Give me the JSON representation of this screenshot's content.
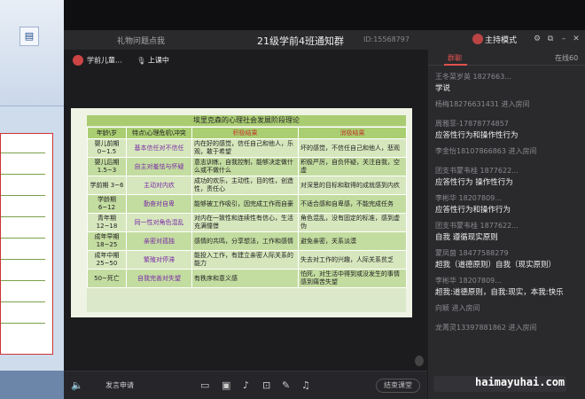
{
  "window": {
    "left_label": "礼物问题点我",
    "title": "21级学前4班通知群",
    "id_label": "ID:15568797",
    "host_mode": "主持模式"
  },
  "stage": {
    "presenter_name": "学前儿童...",
    "status": "上课中"
  },
  "slide": {
    "title": "埃里克森的心理社会发展阶段理论",
    "headers": [
      "年龄\\岁",
      "特点\\心理危机\\冲突",
      "积极结果",
      "消极结果"
    ],
    "rows": [
      [
        "婴儿前期 0~1.5",
        "基本信任对不信任",
        "内在好的感觉，信任自己和他人，乐观，敢于希望",
        "坏的感觉，不信任自己和他人，悲观"
      ],
      [
        "婴儿后期 1.5~3",
        "自主对羞怯与怀疑",
        "意志训练，自我控制，能够决定做什么或不做什么",
        "积极严厉，自负怀疑，关注自我，空虚"
      ],
      [
        "学前期 3~6",
        "主动对内疚",
        "成功的欢乐，主动性，目的性，创造性，责任心",
        "对深思的目标和取得的成就感到内疚"
      ],
      [
        "学龄期 6~12",
        "勤奋对自卑",
        "能够被工作吸引，因完成工作而自豪",
        "不适合感和自卑感，不能完成任务"
      ],
      [
        "青年期 12~18",
        "同一性对角色混乱",
        "对内在一致性和连续性有信心，生活充满憧憬",
        "角色混乱，没有固定的标准，感到虚伪"
      ],
      [
        "成年早期 18~25",
        "亲密对孤独",
        "感情的共鸣，分享想法，工作和感情",
        "避免亲密，关系淡漠"
      ],
      [
        "成年中期 25~50",
        "繁殖对停滞",
        "能投入工作，有建立亲密人际关系的能力",
        "失去对工作的兴趣，人际关系贫乏"
      ],
      [
        "50~死亡",
        "自我完善对失望",
        "有秩序和意义感",
        "怕死，对生活中得到或没发生的事情感到痛苦失望"
      ]
    ]
  },
  "toolbar": {
    "speak_label": "发言申请",
    "end_label": "结束课堂"
  },
  "chat": {
    "tab_active": "群聊",
    "tab_online": "在线60",
    "messages": [
      {
        "kind": "sender",
        "badge": true,
        "text": "王冬菜岁英 1827663..."
      },
      {
        "kind": "text",
        "text": "学说"
      },
      {
        "kind": "join",
        "text": "杨梅18276631431 进入房间"
      },
      {
        "kind": "sender",
        "badge": false,
        "text": "周雅菲-17878774857"
      },
      {
        "kind": "text",
        "text": "应答性行为和操作性行为"
      },
      {
        "kind": "join",
        "text": "李金怡18107866863 进入房间"
      },
      {
        "kind": "sender",
        "badge": true,
        "text": "团支书蒙韦桂 1877622..."
      },
      {
        "kind": "text",
        "text": "应答性行为 操作性行为"
      },
      {
        "kind": "sender",
        "badge": false,
        "text": "李彬华   18207809..."
      },
      {
        "kind": "text",
        "text": "应答性行为和操作行为"
      },
      {
        "kind": "sender",
        "badge": true,
        "text": "团支书蒙韦桂 1877622..."
      },
      {
        "kind": "text",
        "text": "自我 遵循现实原则"
      },
      {
        "kind": "sender",
        "badge": false,
        "text": "蒙凤茵 18477588279"
      },
      {
        "kind": "text",
        "text": "超我（道德原则）自我（现实原则）"
      },
      {
        "kind": "sender",
        "badge": false,
        "text": "李彬华   18207809..."
      },
      {
        "kind": "text",
        "text": "超我:道德原则，自我:现实，本我:快乐"
      },
      {
        "kind": "join",
        "text": "向颖 进入房间"
      },
      {
        "kind": "join",
        "text": "龙菁灵13397881862 进入房间"
      }
    ]
  },
  "watermark": "haimayuhai.com",
  "colors": {
    "accent": "#e0524c",
    "slide_header": "#a9cc71",
    "slide_row": "#d6e7bd"
  }
}
